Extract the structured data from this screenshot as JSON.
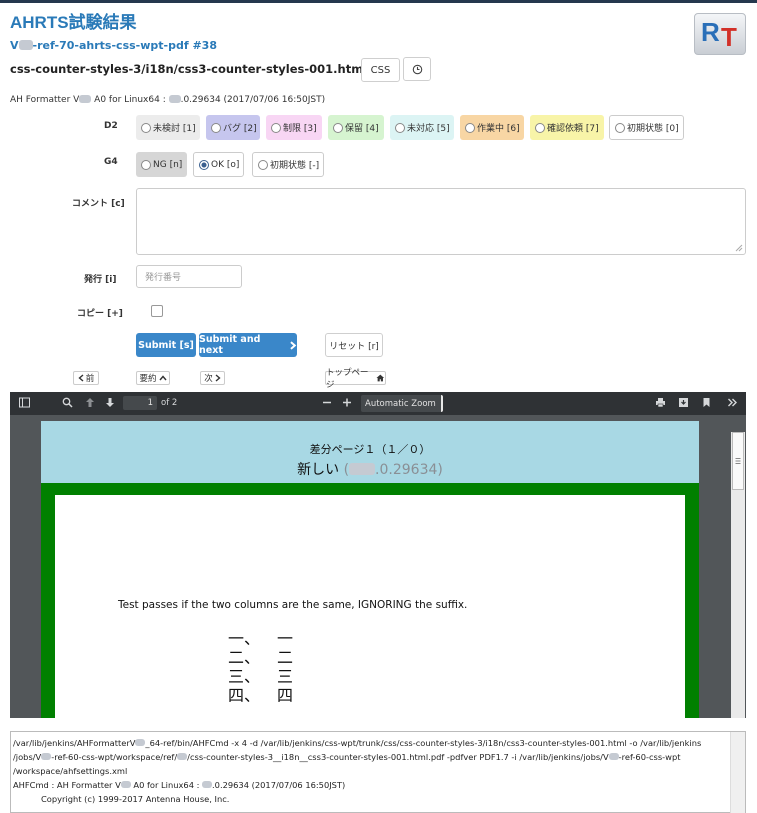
{
  "header": {
    "title": "AHRTS試験結果",
    "subtitle_prefix": "V",
    "subtitle_suffix": "-ref-70-ahrts-css-wpt-pdf #38",
    "filename": "css-counter-styles-3/i18n/css3-counter-styles-001.html",
    "css_button": "CSS",
    "time_icon": "clock-icon",
    "logo_r": "R",
    "logo_t": "T"
  },
  "formatter": {
    "prefix": "AH Formatter V",
    "middle": " A0 for Linux64 : ",
    "suffix": ".0.29634 (2017/07/06 16:50JST)"
  },
  "d2": {
    "label": "D2",
    "options": [
      {
        "label": "未検討 [1]",
        "color": "#ececec",
        "selected": false
      },
      {
        "label": "バグ [2]",
        "color": "#c6c6ee",
        "selected": false
      },
      {
        "label": "制限 [3]",
        "color": "#f8d6f4",
        "selected": false
      },
      {
        "label": "保留 [4]",
        "color": "#d6f4d0",
        "selected": false
      },
      {
        "label": "未対応 [5]",
        "color": "#dcf4f4",
        "selected": false
      },
      {
        "label": "作業中 [6]",
        "color": "#f8d6a4",
        "selected": false
      },
      {
        "label": "確認依頼 [7]",
        "color": "#f8f4a8",
        "selected": false
      },
      {
        "label": "初期状態 [0]",
        "color": "#ffffff",
        "selected": false
      }
    ]
  },
  "g4": {
    "label": "G4",
    "options": [
      {
        "label": "NG [n]",
        "color": "#d6d6d6",
        "selected": false
      },
      {
        "label": "OK [o]",
        "color": "#ffffff",
        "selected": true
      },
      {
        "label": "初期状態 [-]",
        "color": "#ffffff",
        "selected": false
      }
    ]
  },
  "comment": {
    "label": "コメント [c]",
    "value": ""
  },
  "issue": {
    "label": "発行 [i]",
    "placeholder": "発行番号"
  },
  "copy": {
    "label": "コピー [+]"
  },
  "actions": {
    "submit": "Submit [s]",
    "submit_next": "Submit and next",
    "reset": "リセット [r]"
  },
  "nav": {
    "prev": "前",
    "summary": "要約",
    "next": "次",
    "top": "トップページ"
  },
  "pdf": {
    "page": "1",
    "of": "of 2",
    "zoom": "Automatic Zoom",
    "diff_title": "差分ページ１（１／０）",
    "new_label": "新しい",
    "version_open": "(",
    "version_suffix": ".0.29634)",
    "test_text": "Test passes if the two columns are the same, IGNORING the suffix.",
    "left_column": [
      "一、",
      "二、",
      "三、",
      "四、"
    ],
    "right_column": [
      "一",
      "二",
      "三",
      "四"
    ]
  },
  "log": {
    "line1": "/var/lib/jenkins/AHFormatterV",
    "line1b": "_64-ref/bin/AHFCmd -x 4 -d /var/lib/jenkins/css-wpt/trunk/css/css-counter-styles-3/i18n/css3-counter-styles-001.html -o /var/lib/jenkins",
    "line2a": "/jobs/V",
    "line2b": "-ref-60-css-wpt/workspace/ref/",
    "line2c": "/css-counter-styles-3__i18n__css3-counter-styles-001.html.pdf -pdfver PDF1.7 -i /var/lib/jenkins/jobs/V",
    "line2d": "-ref-60-css-wpt",
    "line3": "/workspace/ahfsettings.xml",
    "line4a": "AHFCmd : AH Formatter V",
    "line4b": " A0 for Linux64 : ",
    "line4c": ".0.29634 (2017/07/06 16:50JST)",
    "line5": "Copyright (c) 1999-2017 Antenna House, Inc."
  }
}
